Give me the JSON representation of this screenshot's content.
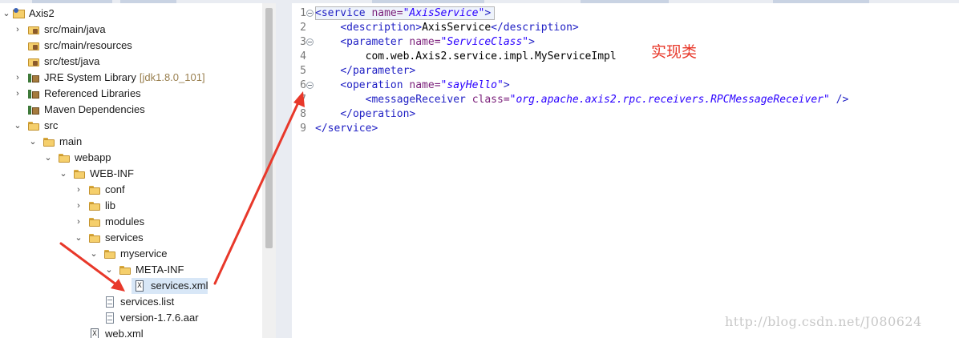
{
  "tree": {
    "rows": [
      {
        "label": "Axis2",
        "icon": "project-icon",
        "deco": ""
      },
      {
        "label": "src/main/java",
        "icon": "source-folder-icon",
        "deco": ""
      },
      {
        "label": "src/main/resources",
        "icon": "source-folder-icon",
        "deco": ""
      },
      {
        "label": "src/test/java",
        "icon": "source-folder-icon",
        "deco": ""
      },
      {
        "label": "JRE System Library",
        "icon": "library-icon",
        "deco": "[jdk1.8.0_101]"
      },
      {
        "label": "Referenced Libraries",
        "icon": "library-icon",
        "deco": ""
      },
      {
        "label": "Maven Dependencies",
        "icon": "library-icon",
        "deco": ""
      },
      {
        "label": "src",
        "icon": "folder-icon",
        "deco": ""
      },
      {
        "label": "main",
        "icon": "folder-icon",
        "deco": ""
      },
      {
        "label": "webapp",
        "icon": "folder-icon",
        "deco": ""
      },
      {
        "label": "WEB-INF",
        "icon": "folder-icon",
        "deco": ""
      },
      {
        "label": "conf",
        "icon": "folder-icon",
        "deco": ""
      },
      {
        "label": "lib",
        "icon": "folder-icon",
        "deco": ""
      },
      {
        "label": "modules",
        "icon": "folder-icon",
        "deco": ""
      },
      {
        "label": "services",
        "icon": "folder-icon",
        "deco": ""
      },
      {
        "label": "myservice",
        "icon": "folder-icon",
        "deco": ""
      },
      {
        "label": "META-INF",
        "icon": "folder-icon",
        "deco": ""
      },
      {
        "label": "services.xml",
        "icon": "xml-file-icon",
        "deco": ""
      },
      {
        "label": "services.list",
        "icon": "file-icon",
        "deco": ""
      },
      {
        "label": "version-1.7.6.aar",
        "icon": "file-icon",
        "deco": ""
      },
      {
        "label": "web.xml",
        "icon": "xml-file-icon",
        "deco": ""
      }
    ]
  },
  "editor": {
    "line_numbers": [
      "1",
      "2",
      "3",
      "4",
      "5",
      "6",
      "7",
      "8",
      "9"
    ],
    "lines": {
      "l1": {
        "open": "<service ",
        "attr": "name=",
        "val": "\"AxisService\"",
        "close": ">"
      },
      "l2": {
        "indent": "    ",
        "open": "<description>",
        "text": "AxisService",
        "close": "</description>"
      },
      "l3": {
        "indent": "    ",
        "open": "<parameter ",
        "attr": "name=",
        "val": "\"ServiceClass\"",
        "close": ">"
      },
      "l4": {
        "indent": "        ",
        "text": "com.web.Axis2.service.impl.MyServiceImpl"
      },
      "l5": {
        "indent": "    ",
        "close": "</parameter>"
      },
      "l6": {
        "indent": "    ",
        "open": "<operation ",
        "attr": "name=",
        "val": "\"sayHello\"",
        "close": ">"
      },
      "l7": {
        "indent": "        ",
        "open": "<messageReceiver ",
        "attr": "class=",
        "val": "\"org.apache.axis2.rpc.receivers.RPCMessageReceiver\"",
        "close": " />"
      },
      "l8": {
        "indent": "    ",
        "close": "</operation>"
      },
      "l9": {
        "close": "</service>"
      }
    },
    "annotation": "实现类",
    "watermark": "http://blog.csdn.net/J080624"
  },
  "colors": {
    "tag": "#1f1fc4",
    "attribute": "#7a1f7a",
    "attribute_value": "#2a00ff",
    "annotation_red": "#e8382a",
    "selection": "#d8e7f7"
  }
}
